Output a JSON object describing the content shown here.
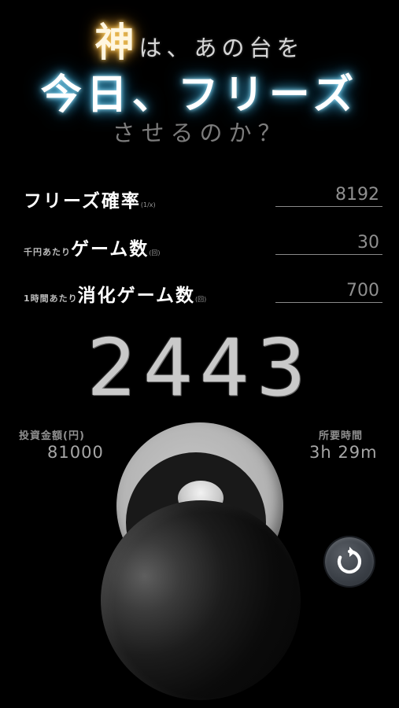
{
  "header": {
    "kami": "神",
    "line1_rest": "は、あの台を",
    "line2": "今日、フリーズ",
    "line3": "させるのか？"
  },
  "settings": {
    "freeze_prob": {
      "label_main": "フリーズ確率",
      "label_unit": "(1/x)",
      "value": "8192"
    },
    "games_per_1000": {
      "label_prefix": "千円あたり",
      "label_main": "ゲーム数",
      "label_unit": "(回)",
      "value": "30"
    },
    "games_per_hour": {
      "label_prefix": "1時間あたり",
      "label_main": "消化ゲーム数",
      "label_unit": "(回)",
      "value": "700"
    }
  },
  "result": {
    "games": "2443",
    "investment_label": "投資金額(円)",
    "investment_value": "81000",
    "time_label": "所要時間",
    "time_value": "3h 29m"
  },
  "icons": {
    "reset": "refresh-icon",
    "knob": "knob-icon"
  },
  "colors": {
    "background": "#000000",
    "kami_glow": "#e8a93a",
    "title_glow": "#4fc4ee"
  }
}
